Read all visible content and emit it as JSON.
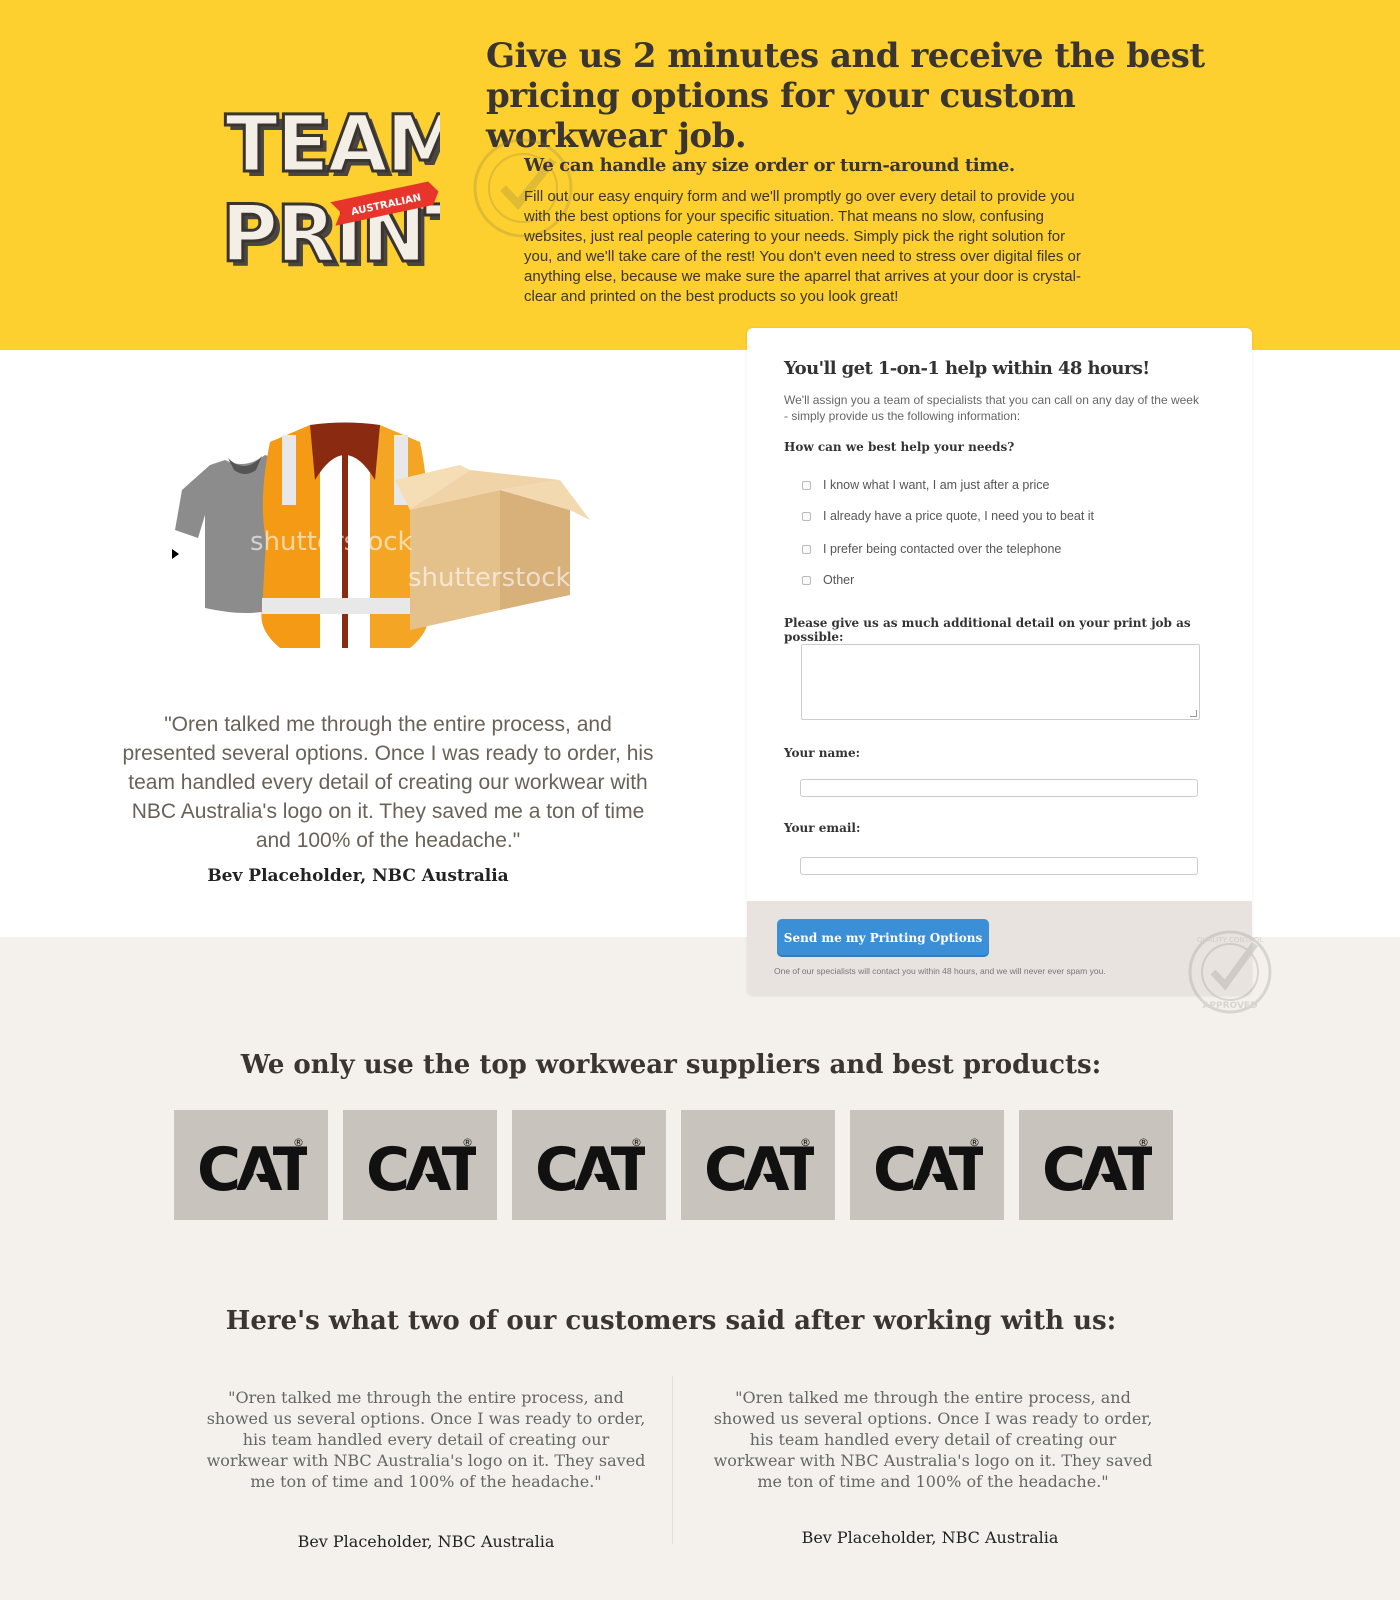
{
  "hero": {
    "headline": "Give us 2 minutes and receive the best pricing options for your custom workwear job.",
    "subheadline": "We can handle any size order or turn-around time.",
    "body": "Fill out our easy enquiry form and we'll promptly go over every detail to provide you with the best options for your specific situation. That means no slow, confusing websites, just real people catering to your needs. Simply pick the right solution for you, and we'll take care of the rest! You don't even need to stress over digital files or anything else, because we make sure the aparrel that arrives at your door is crystal-clear and printed on the best products so you look great!"
  },
  "logo": {
    "line1": "TEAM",
    "line2": "PRINT",
    "ribbon": "AUSTRALIAN"
  },
  "product_image": {
    "watermark_1": "shutterstock",
    "watermark_2": "shutterstock"
  },
  "featured_testimonial": {
    "quote": "\"Oren talked me through the entire process, and presented several options. Once I was ready to order, his team handled every detail of creating our workwear with NBC Australia's logo on it. They saved me a ton of time and 100% of the headache.\"",
    "author": "Bev Placeholder, NBC Australia"
  },
  "form": {
    "title": "You'll get 1-on-1 help within 48 hours!",
    "intro": "We'll assign you a team of specialists that you can call on any day of the week - simply provide us the following information:",
    "needs_label": "How can we best help your needs?",
    "options": [
      "I know what I want, I am just after a price",
      "I already have a price quote, I need you to beat it",
      "I prefer being contacted over the telephone",
      "Other"
    ],
    "details_label": "Please give us as much additional detail on your print job as possible:",
    "details_value": "",
    "name_label": "Your name:",
    "name_value": "",
    "email_label": "Your email:",
    "email_value": "",
    "submit_label": "Send me my Printing Options",
    "footnote": "One of our specialists will contact you within 48 hours, and we will never ever spam you."
  },
  "stamp": {
    "top_text": "QUALITY CONTROL",
    "bottom_text": "APPROVED"
  },
  "suppliers": {
    "title": "We only use the top workwear suppliers and best products:",
    "brands": [
      "CAT",
      "CAT",
      "CAT",
      "CAT",
      "CAT",
      "CAT"
    ]
  },
  "testimonials": {
    "title": "Here's what two of our customers said after working with us:",
    "items": [
      {
        "quote": "\"Oren talked me through the entire process, and showed us several options. Once I was ready to order, his team handled every detail of creating our workwear with NBC Australia's logo on it. They saved me  ton of time and 100% of the headache.\"",
        "author": "Bev Placeholder, NBC Australia"
      },
      {
        "quote": "\"Oren talked me through the entire process, and showed us several options. Once I was ready to order, his team handled every detail of creating our workwear with NBC Australia's logo on it. They saved me  ton of time and 100% of the headache.\"",
        "author": "Bev Placeholder, NBC Australia"
      }
    ]
  },
  "colors": {
    "hero_bg": "#fdd030",
    "page_bg": "#f4f1ed",
    "button": "#3b8fd6",
    "ribbon": "#e8352b",
    "brand_box": "#c8c3bc"
  }
}
